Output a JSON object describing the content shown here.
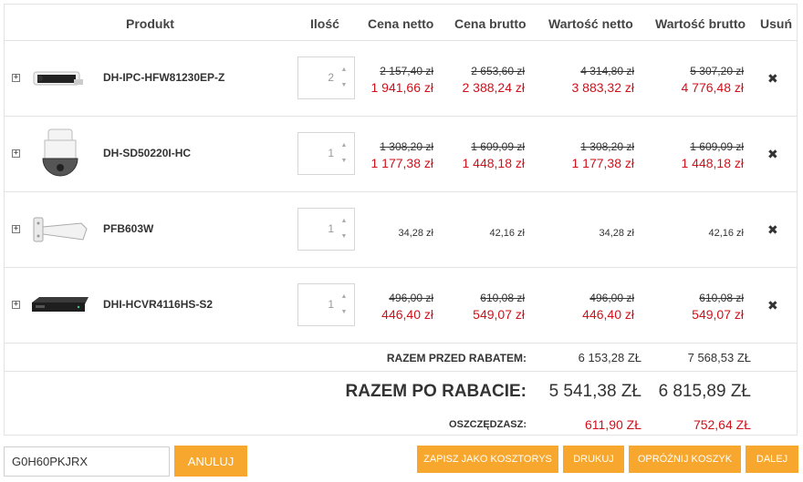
{
  "header": {
    "product": "Produkt",
    "qty": "Ilość",
    "net_price": "Cena netto",
    "gross_price": "Cena brutto",
    "net_value": "Wartość netto",
    "gross_value": "Wartość brutto",
    "remove": "Usuń"
  },
  "items": [
    {
      "name": "DH-IPC-HFW81230EP-Z",
      "qty": "2",
      "net_old": "2 157,40 zł",
      "net_new": "1 941,66 zł",
      "gross_old": "2 653,60 zł",
      "gross_new": "2 388,24 zł",
      "netv_old": "4 314,80 zł",
      "netv_new": "3 883,32 zł",
      "grossv_old": "5 307,20 zł",
      "grossv_new": "4 776,48 zł"
    },
    {
      "name": "DH-SD50220I-HC",
      "qty": "1",
      "net_old": "1 308,20 zł",
      "net_new": "1 177,38 zł",
      "gross_old": "1 609,09 zł",
      "gross_new": "1 448,18 zł",
      "netv_old": "1 308,20 zł",
      "netv_new": "1 177,38 zł",
      "grossv_old": "1 609,09 zł",
      "grossv_new": "1 448,18 zł"
    },
    {
      "name": "PFB603W",
      "qty": "1",
      "net": "34,28 zł",
      "gross": "42,16 zł",
      "netv": "34,28 zł",
      "grossv": "42,16 zł"
    },
    {
      "name": "DHI-HCVR4116HS-S2",
      "qty": "1",
      "net_old": "496,00 zł",
      "net_new": "446,40 zł",
      "gross_old": "610,08 zł",
      "gross_new": "549,07 zł",
      "netv_old": "496,00 zł",
      "netv_new": "446,40 zł",
      "grossv_old": "610,08 zł",
      "grossv_new": "549,07 zł"
    }
  ],
  "remove_glyph": "✖",
  "totals": {
    "before_label": "RAZEM PRZED RABATEM:",
    "before_net": "6 153,28 ZŁ",
    "before_gross": "7 568,53 ZŁ",
    "after_label": "RAZEM PO RABACIE:",
    "after_net": "5 541,38 ZŁ",
    "after_gross": "6 815,89 ZŁ",
    "save_label": "OSZCZĘDZASZ:",
    "save_net": "611,90 ZŁ",
    "save_gross": "752,64 ZŁ"
  },
  "coupon": {
    "value": "G0H60PKJRX",
    "cancel_label": "ANULUJ"
  },
  "actions": {
    "save_estimate": "ZAPISZ JAKO KOSZTORYS",
    "print": "DRUKUJ",
    "empty_cart": "OPRÓŻNIJ KOSZYK",
    "next": "DALEJ"
  },
  "colors": {
    "accent": "#f7a72d",
    "discount": "#d0111b"
  }
}
